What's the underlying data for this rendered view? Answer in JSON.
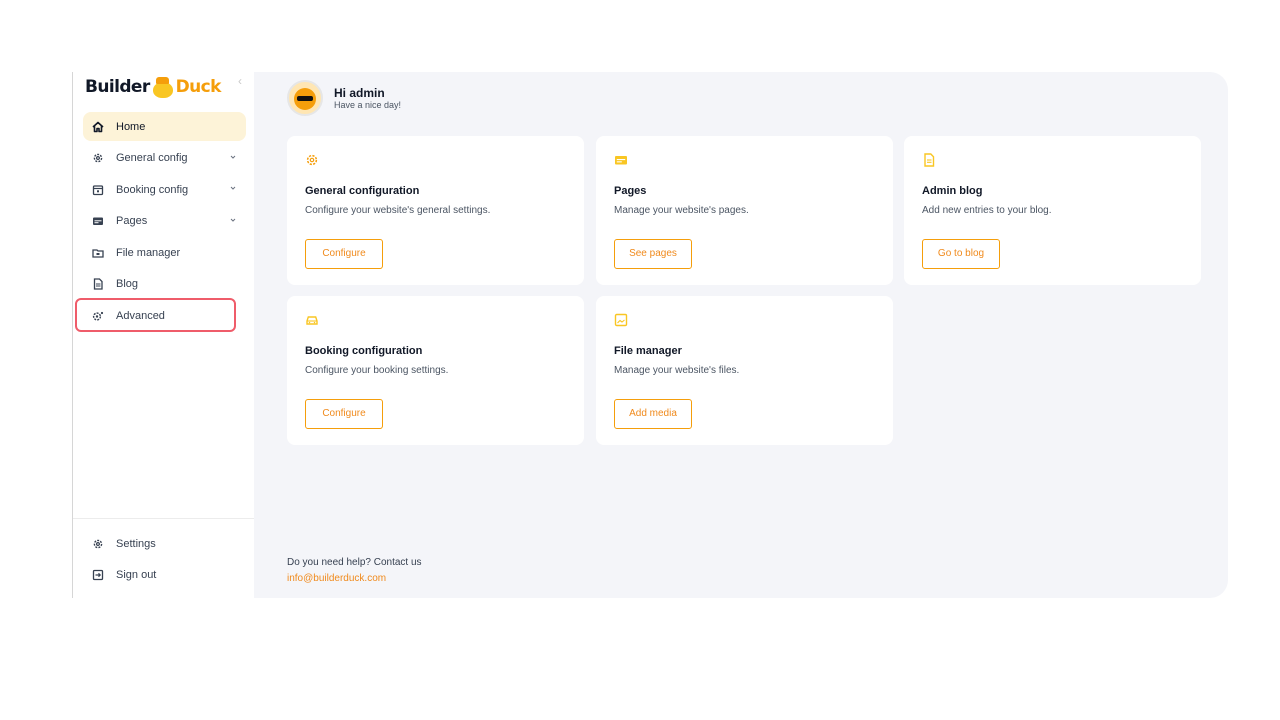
{
  "brand": {
    "part1": "Builder",
    "part2": "Duck"
  },
  "sidebar": {
    "items": [
      {
        "label": "Home",
        "icon": "home-icon",
        "active": true
      },
      {
        "label": "General config",
        "icon": "gear-icon",
        "chevron": true
      },
      {
        "label": "Booking config",
        "icon": "calendar-icon",
        "chevron": true
      },
      {
        "label": "Pages",
        "icon": "pages-icon",
        "chevron": true
      },
      {
        "label": "File manager",
        "icon": "folder-icon"
      },
      {
        "label": "Blog",
        "icon": "document-icon"
      },
      {
        "label": "Advanced",
        "icon": "advanced-gear-icon"
      }
    ],
    "bottom": [
      {
        "label": "Settings",
        "icon": "gear-icon"
      },
      {
        "label": "Sign out",
        "icon": "sign-out-icon"
      }
    ]
  },
  "greeting": {
    "title": "Hi admin",
    "subtitle": "Have a nice day!"
  },
  "cards": [
    {
      "title": "General configuration",
      "description": "Configure your website's general settings.",
      "button": "Configure",
      "icon": "gear-icon"
    },
    {
      "title": "Pages",
      "description": "Manage your website's pages.",
      "button": "See pages",
      "icon": "pages-icon"
    },
    {
      "title": "Admin blog",
      "description": "Add new entries to your blog.",
      "button": "Go to blog",
      "icon": "document-icon"
    },
    {
      "title": "Booking configuration",
      "description": "Configure your booking settings.",
      "button": "Configure",
      "icon": "car-icon"
    },
    {
      "title": "File manager",
      "description": "Manage your website's files.",
      "button": "Add media",
      "icon": "image-icon"
    }
  ],
  "help": {
    "text": "Do you need help? Contact us",
    "email": "info@builderduck.com"
  },
  "colors": {
    "accent": "#f59e0b",
    "accent_text": "#f08a1c",
    "highlight": "#ef5c6a",
    "active_bg": "#fdf3d8",
    "main_bg": "#f4f5f9"
  }
}
